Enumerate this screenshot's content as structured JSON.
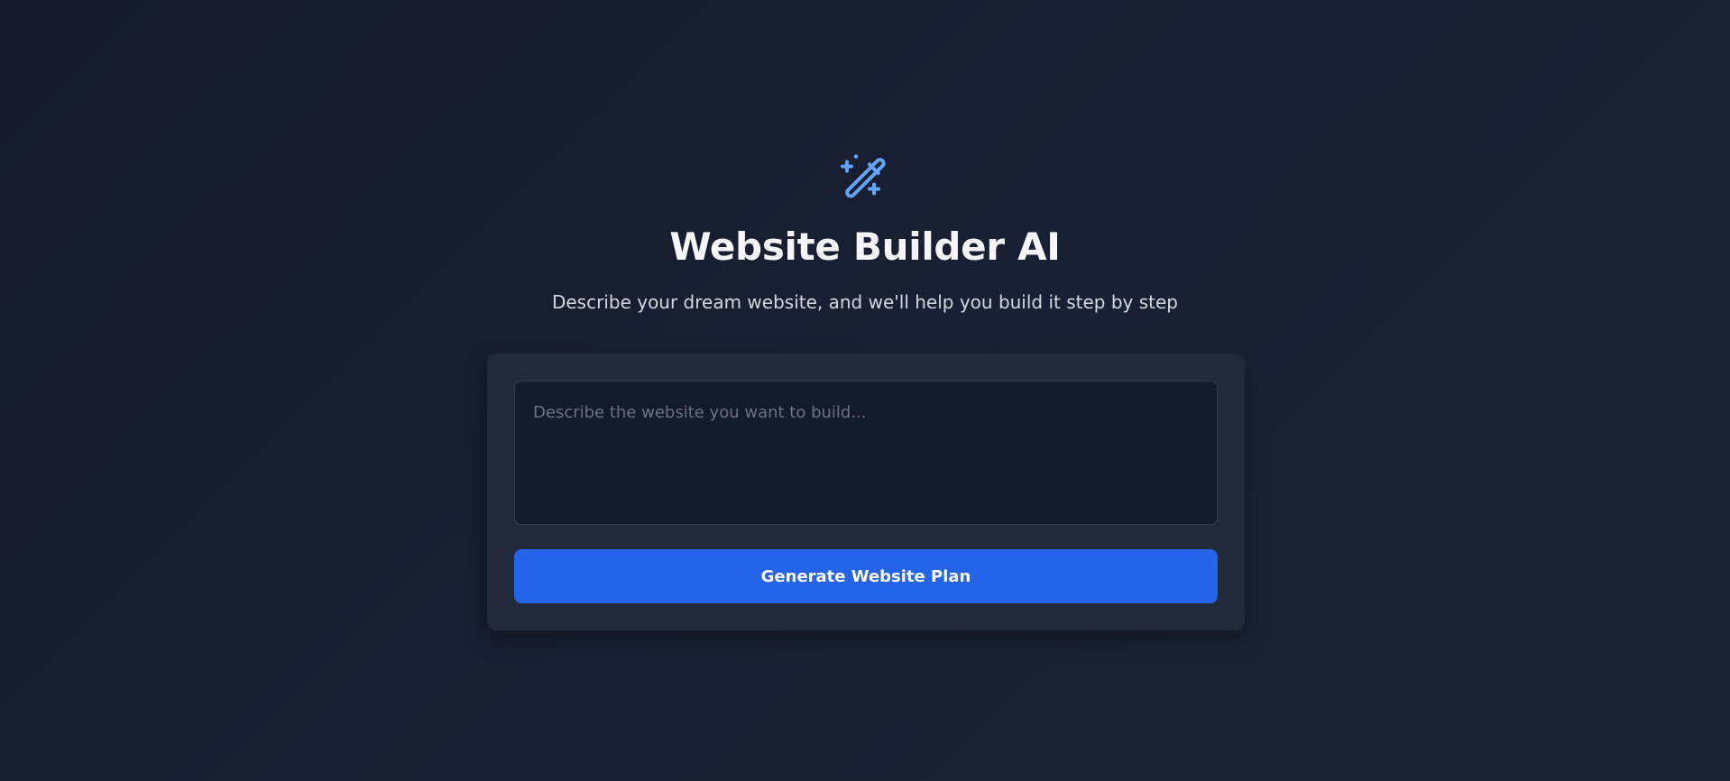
{
  "header": {
    "icon": "magic-wand-icon",
    "title": "Website Builder AI",
    "subtitle": "Describe your dream website, and we'll help you build it step by step"
  },
  "form": {
    "prompt_value": "",
    "prompt_placeholder": "Describe the website you want to build...",
    "generate_label": "Generate Website Plan"
  },
  "colors": {
    "accent": "#2563eb",
    "icon": "#60a5fa",
    "background": "#161d2d",
    "card": "#212a3a"
  }
}
